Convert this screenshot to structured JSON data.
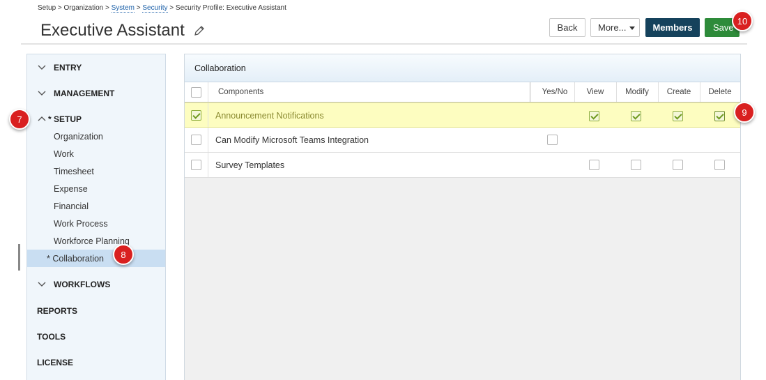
{
  "breadcrumb": {
    "part1": "Setup > Organization > ",
    "system": "System",
    "sep1": " > ",
    "security": "Security",
    "tail": " > Security Profile: Executive Assistant"
  },
  "header": {
    "title": "Executive Assistant",
    "back_label": "Back",
    "more_label": "More...",
    "members_label": "Members",
    "save_label": "Save"
  },
  "sidebar": {
    "entry": "ENTRY",
    "management": "MANAGEMENT",
    "setup": "* SETUP",
    "setup_items": [
      "Organization",
      "Work",
      "Timesheet",
      "Expense",
      "Financial",
      "Work Process",
      "Workforce Planning",
      "* Collaboration"
    ],
    "workflows": "WORKFLOWS",
    "reports": "REPORTS",
    "tools": "TOOLS",
    "license": "LICENSE"
  },
  "panel": {
    "title": "Collaboration",
    "columns": {
      "components": "Components",
      "yesno": "Yes/No",
      "view": "View",
      "modify": "Modify",
      "create": "Create",
      "delete": "Delete"
    },
    "rows": [
      {
        "name": "Announcement Notifications",
        "selected": true,
        "highlight": true
      },
      {
        "name": "Can Modify Microsoft Teams Integration",
        "selected": false
      },
      {
        "name": "Survey Templates",
        "selected": false
      }
    ]
  },
  "badges": {
    "b7": "7",
    "b8": "8",
    "b9": "9",
    "b10": "10"
  },
  "colors": {
    "accent_navy": "#15425c",
    "save_green": "#2e8b3a",
    "badge_red": "#d92020",
    "highlight": "#fdfdc0"
  }
}
